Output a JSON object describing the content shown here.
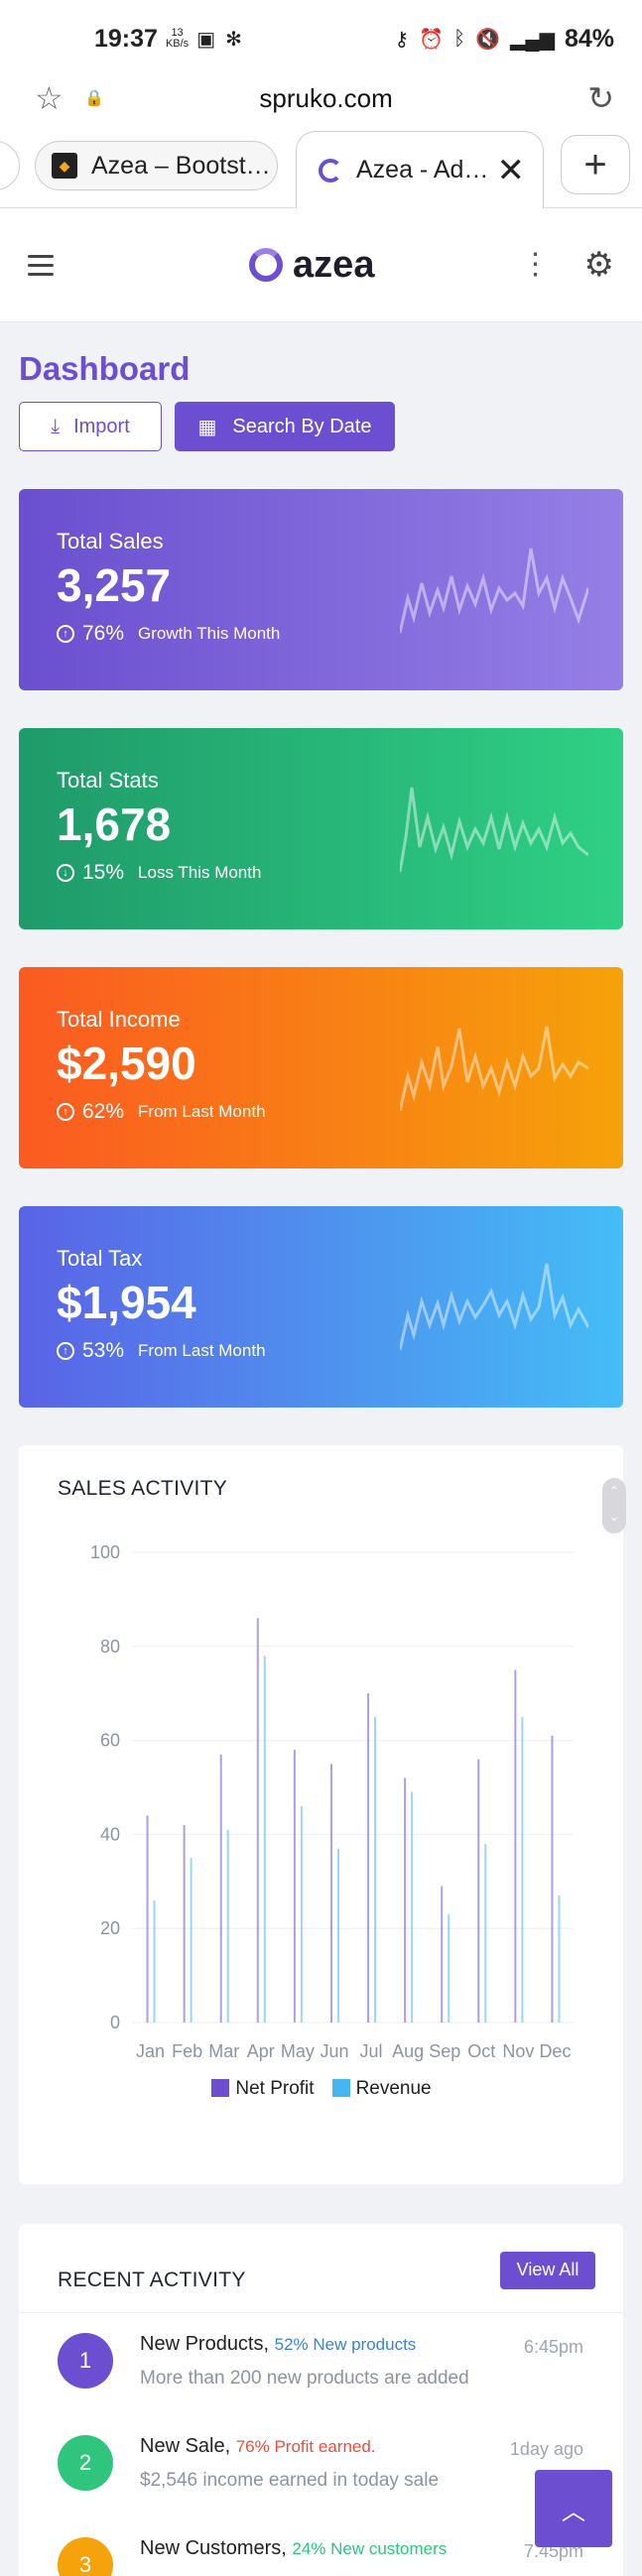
{
  "status_bar": {
    "time": "19:37",
    "net_speed": "13",
    "net_unit": "KB/s",
    "battery": "84%"
  },
  "browser": {
    "url": "spruko.com",
    "tabs": [
      {
        "label": "Azea – Bootst…"
      },
      {
        "label": "Azea - Ad…"
      }
    ]
  },
  "app": {
    "logo_text": "azea"
  },
  "page": {
    "title": "Dashboard",
    "import_label": "Import",
    "search_by_date_label": "Search By Date"
  },
  "stats": [
    {
      "label": "Total Sales",
      "value": "3,257",
      "percent": "76%",
      "note": "Growth This Month",
      "direction": "up"
    },
    {
      "label": "Total Stats",
      "value": "1,678",
      "percent": "15%",
      "note": "Loss This Month",
      "direction": "down"
    },
    {
      "label": "Total Income",
      "value": "$2,590",
      "percent": "62%",
      "note": "From Last Month",
      "direction": "up"
    },
    {
      "label": "Total Tax",
      "value": "$1,954",
      "percent": "53%",
      "note": "From Last Month",
      "direction": "up"
    }
  ],
  "sales_activity": {
    "title": "SALES ACTIVITY",
    "legend": [
      {
        "name": "Net Profit",
        "color": "#6c4fd1"
      },
      {
        "name": "Revenue",
        "color": "#45b6f0"
      }
    ]
  },
  "chart_data": {
    "type": "bar",
    "categories": [
      "Jan",
      "Feb",
      "Mar",
      "Apr",
      "May",
      "Jun",
      "Jul",
      "Aug",
      "Sep",
      "Oct",
      "Nov",
      "Dec"
    ],
    "series": [
      {
        "name": "Net Profit",
        "values": [
          44,
          42,
          57,
          86,
          58,
          55,
          70,
          52,
          29,
          56,
          75,
          61
        ]
      },
      {
        "name": "Revenue",
        "values": [
          26,
          35,
          41,
          78,
          46,
          37,
          65,
          49,
          23,
          38,
          65,
          27
        ]
      }
    ],
    "ylim": [
      0,
      100
    ],
    "yticks": [
      0,
      20,
      40,
      60,
      80,
      100
    ],
    "grid": true,
    "legend_position": "bottom",
    "title": "",
    "xlabel": "",
    "ylabel": ""
  },
  "recent_activity": {
    "title": "RECENT ACTIVITY",
    "view_all_label": "View All",
    "items": [
      {
        "num": "1",
        "title": "New Products,",
        "highlight": "52% New products",
        "highlight_color": "#3b82d6",
        "desc": "More than 200 new products are added",
        "time": "6:45pm",
        "color": "#6c4fd1"
      },
      {
        "num": "2",
        "title": "New Sale,",
        "highlight": "76% Profit earned.",
        "highlight_color": "#ef4b3a",
        "desc": "$2,546 income earned in today sale",
        "time": "1day ago",
        "color": "#2fc57d"
      },
      {
        "num": "3",
        "title": "New Customers,",
        "highlight": "24% New customers",
        "highlight_color": "#2fc57d",
        "desc": "",
        "time": "7.45pm",
        "color": "#f6a20a"
      }
    ]
  },
  "colors": {
    "accent": "#6c4fd1"
  }
}
